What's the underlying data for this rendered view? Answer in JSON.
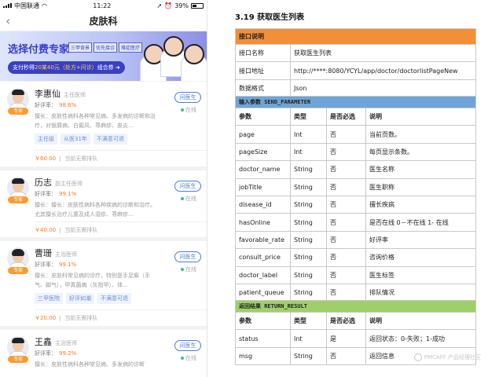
{
  "phone": {
    "status": {
      "carrier": "中国联通",
      "time": "11:22",
      "battery": "39%"
    },
    "nav": {
      "title": "皮肤科"
    },
    "banner": {
      "title": "选择付费专家",
      "tags": [
        "三甲背景",
        "优先接诊",
        "难症医疗"
      ],
      "promo_prefix": "支付秒得",
      "promo_highlight": "20某40元（处方+问诊）",
      "promo_suffix": "组合券"
    },
    "common": {
      "expert_badge": "专家",
      "ask_label": "问医生",
      "online_label": "在线",
      "queue_text": "当前无需排队",
      "rate_label": "好评率："
    },
    "doctors": [
      {
        "name": "李惠仙",
        "title": "主任医师",
        "rate": "98.6%",
        "desc": "擅长：皮肤性病科各种常见病、多发病的诊断和治疗，对银屑病、白癜风、荨麻疹、皮炎…",
        "tags": [
          "主任级",
          "从医31年",
          "不满意可退"
        ],
        "price": "￥60.00"
      },
      {
        "name": "历志",
        "title": "副主任医师",
        "rate": "99.1%",
        "desc": "擅长：擅长：皮肤性病科各种疾病的诊断和治疗。尤其擅长治疗儿童及成人湿疹、荨麻疹…",
        "tags": [],
        "price": "￥40.00"
      },
      {
        "name": "曹珊",
        "title": "主治医师",
        "rate": "99.1%",
        "desc": "擅长：皮肤科常见病的诊疗，特别是手足癣（手气、脚气），甲真菌病（灰指甲）、体…",
        "tags": [
          "三甲医院",
          "好评如潮",
          "不满意可退"
        ],
        "price": "￥20.00"
      },
      {
        "name": "王鑫",
        "title": "主治医师",
        "rate": "99.2%",
        "desc": "擅长：皮肤性病科各种常见病、多发病的诊断",
        "tags": [],
        "price": ""
      }
    ]
  },
  "doc": {
    "section_title": "3.19  获取医生列表",
    "sections": {
      "interface": "接口说明",
      "input": "输入参数 SEND_PARAMETER",
      "output": "返回结果 RETURN_RESULT"
    },
    "interface_rows": [
      {
        "k": "接口名称",
        "v": "获取医生列表"
      },
      {
        "k": "接口地址",
        "v": "http://****:8080/YCYL/app/doctor/doctorlistPageNew"
      },
      {
        "k": "数据格式",
        "v": "Json"
      }
    ],
    "param_headers": [
      "参数",
      "类型",
      "是否必选",
      "说明"
    ],
    "input_params": [
      [
        "page",
        "Int",
        "否",
        "当前页数。"
      ],
      [
        "pageSize",
        "Int",
        "否",
        "每页显示条数。"
      ],
      [
        "doctor_name",
        "String",
        "否",
        "医生名称"
      ],
      [
        "jobTitle",
        "String",
        "否",
        "医生职称"
      ],
      [
        "disease_id",
        "String",
        "否",
        "擅长疾病"
      ],
      [
        "hasOnline",
        "String",
        "否",
        "是否在线 0－不在线 1- 在线"
      ],
      [
        "favorable_rate",
        "String",
        "否",
        "好评率"
      ],
      [
        "consult_price",
        "String",
        "否",
        "咨询价格"
      ],
      [
        "doctor_label",
        "String",
        "否",
        "医生标签"
      ],
      [
        "patient_queue",
        "String",
        "否",
        "排队情况"
      ]
    ],
    "output_params": [
      [
        "status",
        "Int",
        "是",
        "返回状态：0-失败；1-成功"
      ],
      [
        "msg",
        "String",
        "否",
        "返回信息"
      ]
    ],
    "watermark": "PMCAFF 产品经理社区"
  }
}
